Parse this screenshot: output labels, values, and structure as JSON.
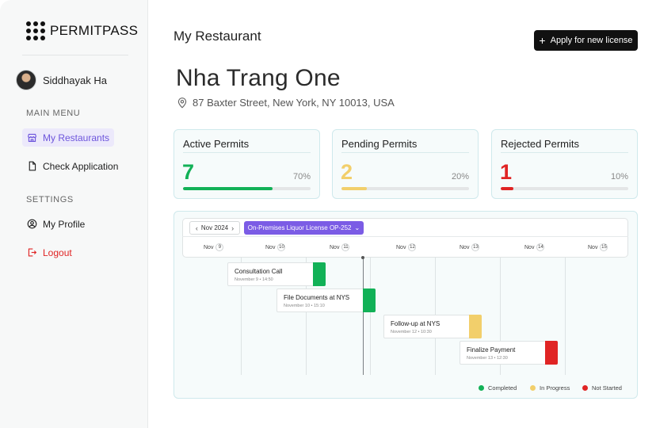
{
  "brand": {
    "name": "PERMITPASS"
  },
  "user": {
    "name": "Siddhayak Ha"
  },
  "sidebar": {
    "main_menu_label": "MAIN MENU",
    "settings_label": "SETTINGS",
    "items": [
      {
        "label": "My Restaurants",
        "icon": "store-icon",
        "active": true
      },
      {
        "label": "Check Application",
        "icon": "document-icon"
      },
      {
        "label": "My Profile",
        "icon": "user-circle-icon"
      },
      {
        "label": "Logout",
        "icon": "logout-icon"
      }
    ]
  },
  "header": {
    "crumb": "My Restaurant",
    "apply_button": "Apply for new license",
    "apply_icon": "+"
  },
  "restaurant": {
    "name": "Nha Trang One",
    "address": "87 Baxter Street, New York, NY 10013, USA"
  },
  "stats": [
    {
      "title": "Active Permits",
      "count": "7",
      "percent_label": "70%",
      "fraction": 0.7,
      "color": "#12b157"
    },
    {
      "title": "Pending Permits",
      "count": "2",
      "percent_label": "20%",
      "fraction": 0.2,
      "color": "#f2cf6b"
    },
    {
      "title": "Rejected Permits",
      "count": "1",
      "percent_label": "10%",
      "fraction": 0.1,
      "color": "#e02424"
    }
  ],
  "timeline": {
    "month": "Nov 2024",
    "license": "On-Premises Liquor License OP-252",
    "days": [
      {
        "label": "Nov",
        "num": "9"
      },
      {
        "label": "Nov",
        "num": "10"
      },
      {
        "label": "Nov",
        "num": "11"
      },
      {
        "label": "Nov",
        "num": "12"
      },
      {
        "label": "Nov",
        "num": "13"
      },
      {
        "label": "Nov",
        "num": "14"
      },
      {
        "label": "Nov",
        "num": "15"
      }
    ],
    "tasks": [
      {
        "title": "Consultation Call",
        "sub": "November 9  •  14:50",
        "status": "completed"
      },
      {
        "title": "File Documents at NYS",
        "sub": "November 10  •  15:10",
        "status": "completed"
      },
      {
        "title": "Follow-up at NYS",
        "sub": "November 12  •  10:30",
        "status": "in-progress"
      },
      {
        "title": "Finalize Payment",
        "sub": "November 13  •  12:30",
        "status": "not-started"
      }
    ],
    "legend": [
      {
        "label": "Completed",
        "color": "#12b157"
      },
      {
        "label": "In Progress",
        "color": "#f2cf6b"
      },
      {
        "label": "Not Started",
        "color": "#e02424"
      }
    ]
  }
}
